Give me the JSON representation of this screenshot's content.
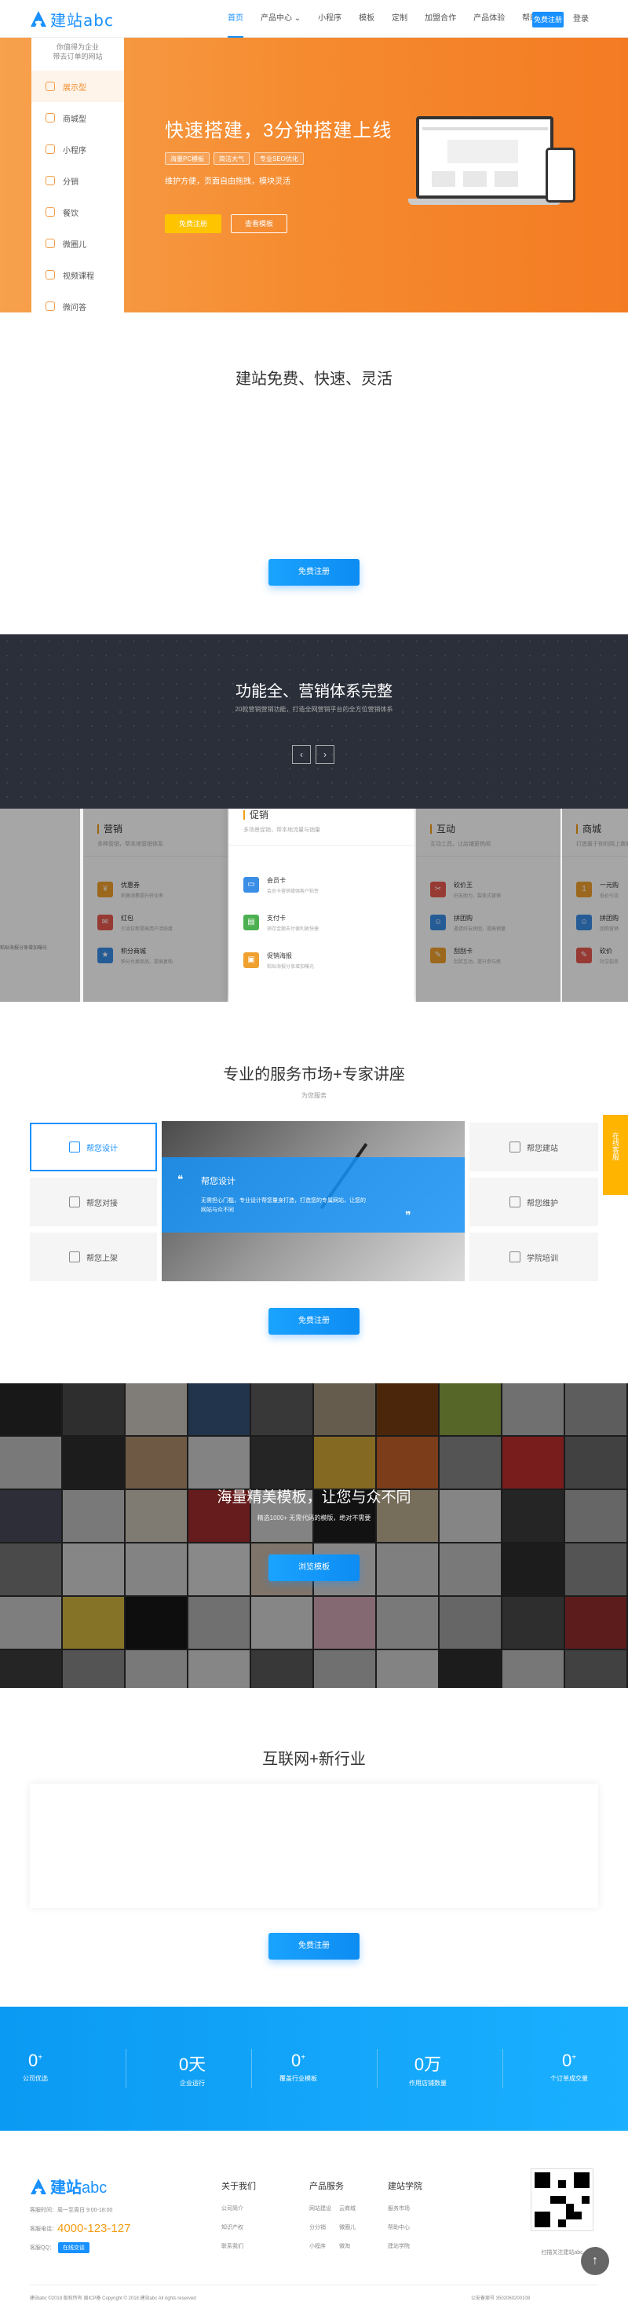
{
  "header": {
    "logo_text": "建站",
    "logo_text_suffix": "abc",
    "nav": [
      {
        "label": "首页"
      },
      {
        "label": "产品中心 ⌄"
      },
      {
        "label": "小程序"
      },
      {
        "label": "模板"
      },
      {
        "label": "定制"
      },
      {
        "label": "加盟合作"
      },
      {
        "label": "产品体验"
      },
      {
        "label": "帮助中心"
      }
    ],
    "register": "免费注册",
    "login": "登录"
  },
  "sidemenu": {
    "heading_line1": "你值得为企业",
    "heading_line2": "带去订单的网站",
    "items": [
      {
        "label": "展示型"
      },
      {
        "label": "商城型"
      },
      {
        "label": "小程序"
      },
      {
        "label": "分销"
      },
      {
        "label": "餐饮"
      },
      {
        "label": "微圈儿"
      },
      {
        "label": "视频课程"
      },
      {
        "label": "微问答"
      }
    ]
  },
  "hero": {
    "title": "快速搭建，3分钟搭建上线",
    "tags": [
      "海量PC模板",
      "简洁大气",
      "专业SEO优化"
    ],
    "subtitle": "维护方便，页面自由拖拽，模块灵活",
    "btn_primary": "免费注册",
    "btn_secondary": "查看模板"
  },
  "intro": {
    "title": "建站免费、快速、灵活",
    "button": "免费注册"
  },
  "marketing": {
    "title": "功能全、营销体系完整",
    "subtitle": "20款营销营销功能，打造全网营销平台的全方位营销体系",
    "prev": "‹",
    "next": "›",
    "cards": [
      {
        "title": "营销",
        "sub": "多种营销，帮本地营销体系",
        "rows": [
          {
            "t1": "优惠券",
            "t2": "刺激消费提升转化率"
          },
          {
            "t1": "红包",
            "t2": "引流拉新提高用户活跃度"
          },
          {
            "t1": "积分商城",
            "t2": "积分兑换商品，提高复购"
          }
        ]
      },
      {
        "title": "促销",
        "sub": "多场景促销，帮本地流量与销量",
        "rows": [
          {
            "t1": "会员卡",
            "t2": "会员卡营销增强客户粘性"
          },
          {
            "t1": "支付卡",
            "t2": "预存金额支付便利更快捷"
          },
          {
            "t1": "促销海报",
            "t2": "粘贴海报分享增加曝光"
          }
        ]
      },
      {
        "title": "互动",
        "sub": "互动工具，让店铺更热闹",
        "rows": [
          {
            "t1": "砍价王",
            "t2": "好友助力，裂变式营销"
          },
          {
            "t1": "拼团购",
            "t2": "邀请好友拼团，提高销量"
          },
          {
            "t1": "刮刮卡",
            "t2": "刮奖互动，提升参与感"
          }
        ]
      },
      {
        "title": "商城",
        "sub": "打造属于你的网上商城",
        "rows": [
          {
            "t1": "一元购",
            "t2": "低价引流"
          },
          {
            "t1": "拼团购",
            "t2": "团购营销"
          },
          {
            "t1": "砍价",
            "t2": "社交裂变"
          }
        ]
      }
    ]
  },
  "service": {
    "title": "专业的服务市场+专家讲座",
    "subtitle": "为您服务",
    "items": [
      {
        "label": "帮您设计"
      },
      {
        "label": "帮您对接"
      },
      {
        "label": "帮您上架"
      },
      {
        "label": "帮您建站"
      },
      {
        "label": "帮您维护"
      },
      {
        "label": "学院培训"
      }
    ],
    "feature_title": "帮您设计",
    "feature_text": "无需担心门槛，专业设计帮您量身打造，打造您的专属网站，让您的网站与众不同",
    "button": "免费注册",
    "float_label": "在线客服"
  },
  "templates": {
    "title": "海量精美模板，让您与众不同",
    "subtitle": "精选1000+ 无需代码的模版，绝对不需要",
    "button": "浏览模板"
  },
  "industry": {
    "title": "互联网+新行业",
    "button": "免费注册"
  },
  "stats": [
    {
      "value": "0",
      "suffix": "+",
      "label": "公司优选"
    },
    {
      "value": "0天",
      "suffix": "",
      "label": "企业运行"
    },
    {
      "value": "0",
      "suffix": "+",
      "label": "覆盖行业模板"
    },
    {
      "value": "0万",
      "suffix": "",
      "label": "作用店铺数量"
    },
    {
      "value": "0",
      "suffix": "+",
      "label": "个订单成交量"
    }
  ],
  "footer": {
    "hours": "客服时间：周一至周日 9:00-18:00",
    "phone_label": "客服电话：",
    "phone": "4000-123-127",
    "qq_label": "客服QQ：",
    "qq_btn": "在线交谈",
    "cols": [
      {
        "title": "关于我们",
        "links": [
          "公司简介",
          "知识产权",
          "联系我们"
        ]
      },
      {
        "title": "产品服务",
        "links": [
          "网站建设",
          "分分销",
          "小程序",
          "云商城",
          "微圈儿",
          "微淘"
        ]
      },
      {
        "title": "建站学院",
        "links": [
          "服务市场",
          "帮助中心",
          "建站学院"
        ]
      }
    ],
    "qr_caption": "扫描关注建站abc",
    "copyright": "建站abc ©2018 版权所有 闽ICP备 Copyright © 2018 建站abc All rights reserved",
    "beian": "公安备案号 3502060200108",
    "top": "↑"
  }
}
